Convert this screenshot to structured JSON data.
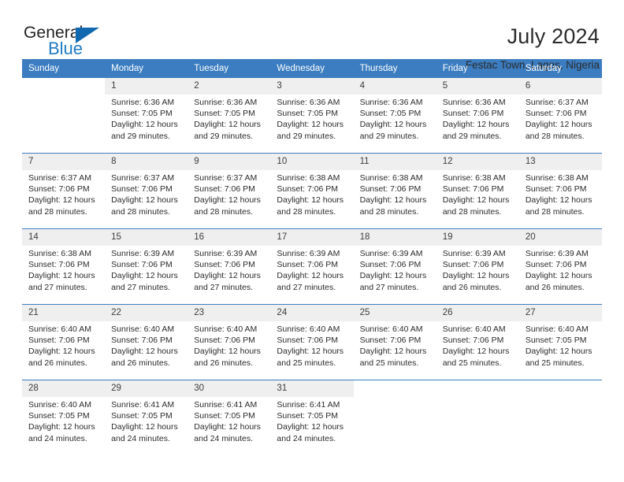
{
  "brand": {
    "name_top": "General",
    "name_bottom": "Blue",
    "triangle_icon": "blue-triangle-icon",
    "color_top": "#221f1f",
    "color_bottom": "#1f7ac4"
  },
  "header": {
    "title": "July 2024",
    "subtitle": "Festac Town, Lagos, Nigeria"
  },
  "theme": {
    "header_bg": "#3b7dc0",
    "daynum_bg": "#efefef",
    "grid_line": "#3b7dc0",
    "text": "#2b2b2b"
  },
  "weekday_headers": [
    "Sunday",
    "Monday",
    "Tuesday",
    "Wednesday",
    "Thursday",
    "Friday",
    "Saturday"
  ],
  "weeks": [
    [
      {
        "day": "",
        "lines": [
          "",
          "",
          "",
          ""
        ]
      },
      {
        "day": "1",
        "lines": [
          "Sunrise: 6:36 AM",
          "Sunset: 7:05 PM",
          "Daylight: 12 hours",
          "and 29 minutes."
        ]
      },
      {
        "day": "2",
        "lines": [
          "Sunrise: 6:36 AM",
          "Sunset: 7:05 PM",
          "Daylight: 12 hours",
          "and 29 minutes."
        ]
      },
      {
        "day": "3",
        "lines": [
          "Sunrise: 6:36 AM",
          "Sunset: 7:05 PM",
          "Daylight: 12 hours",
          "and 29 minutes."
        ]
      },
      {
        "day": "4",
        "lines": [
          "Sunrise: 6:36 AM",
          "Sunset: 7:05 PM",
          "Daylight: 12 hours",
          "and 29 minutes."
        ]
      },
      {
        "day": "5",
        "lines": [
          "Sunrise: 6:36 AM",
          "Sunset: 7:06 PM",
          "Daylight: 12 hours",
          "and 29 minutes."
        ]
      },
      {
        "day": "6",
        "lines": [
          "Sunrise: 6:37 AM",
          "Sunset: 7:06 PM",
          "Daylight: 12 hours",
          "and 28 minutes."
        ]
      }
    ],
    [
      {
        "day": "7",
        "lines": [
          "Sunrise: 6:37 AM",
          "Sunset: 7:06 PM",
          "Daylight: 12 hours",
          "and 28 minutes."
        ]
      },
      {
        "day": "8",
        "lines": [
          "Sunrise: 6:37 AM",
          "Sunset: 7:06 PM",
          "Daylight: 12 hours",
          "and 28 minutes."
        ]
      },
      {
        "day": "9",
        "lines": [
          "Sunrise: 6:37 AM",
          "Sunset: 7:06 PM",
          "Daylight: 12 hours",
          "and 28 minutes."
        ]
      },
      {
        "day": "10",
        "lines": [
          "Sunrise: 6:38 AM",
          "Sunset: 7:06 PM",
          "Daylight: 12 hours",
          "and 28 minutes."
        ]
      },
      {
        "day": "11",
        "lines": [
          "Sunrise: 6:38 AM",
          "Sunset: 7:06 PM",
          "Daylight: 12 hours",
          "and 28 minutes."
        ]
      },
      {
        "day": "12",
        "lines": [
          "Sunrise: 6:38 AM",
          "Sunset: 7:06 PM",
          "Daylight: 12 hours",
          "and 28 minutes."
        ]
      },
      {
        "day": "13",
        "lines": [
          "Sunrise: 6:38 AM",
          "Sunset: 7:06 PM",
          "Daylight: 12 hours",
          "and 28 minutes."
        ]
      }
    ],
    [
      {
        "day": "14",
        "lines": [
          "Sunrise: 6:38 AM",
          "Sunset: 7:06 PM",
          "Daylight: 12 hours",
          "and 27 minutes."
        ]
      },
      {
        "day": "15",
        "lines": [
          "Sunrise: 6:39 AM",
          "Sunset: 7:06 PM",
          "Daylight: 12 hours",
          "and 27 minutes."
        ]
      },
      {
        "day": "16",
        "lines": [
          "Sunrise: 6:39 AM",
          "Sunset: 7:06 PM",
          "Daylight: 12 hours",
          "and 27 minutes."
        ]
      },
      {
        "day": "17",
        "lines": [
          "Sunrise: 6:39 AM",
          "Sunset: 7:06 PM",
          "Daylight: 12 hours",
          "and 27 minutes."
        ]
      },
      {
        "day": "18",
        "lines": [
          "Sunrise: 6:39 AM",
          "Sunset: 7:06 PM",
          "Daylight: 12 hours",
          "and 27 minutes."
        ]
      },
      {
        "day": "19",
        "lines": [
          "Sunrise: 6:39 AM",
          "Sunset: 7:06 PM",
          "Daylight: 12 hours",
          "and 26 minutes."
        ]
      },
      {
        "day": "20",
        "lines": [
          "Sunrise: 6:39 AM",
          "Sunset: 7:06 PM",
          "Daylight: 12 hours",
          "and 26 minutes."
        ]
      }
    ],
    [
      {
        "day": "21",
        "lines": [
          "Sunrise: 6:40 AM",
          "Sunset: 7:06 PM",
          "Daylight: 12 hours",
          "and 26 minutes."
        ]
      },
      {
        "day": "22",
        "lines": [
          "Sunrise: 6:40 AM",
          "Sunset: 7:06 PM",
          "Daylight: 12 hours",
          "and 26 minutes."
        ]
      },
      {
        "day": "23",
        "lines": [
          "Sunrise: 6:40 AM",
          "Sunset: 7:06 PM",
          "Daylight: 12 hours",
          "and 26 minutes."
        ]
      },
      {
        "day": "24",
        "lines": [
          "Sunrise: 6:40 AM",
          "Sunset: 7:06 PM",
          "Daylight: 12 hours",
          "and 25 minutes."
        ]
      },
      {
        "day": "25",
        "lines": [
          "Sunrise: 6:40 AM",
          "Sunset: 7:06 PM",
          "Daylight: 12 hours",
          "and 25 minutes."
        ]
      },
      {
        "day": "26",
        "lines": [
          "Sunrise: 6:40 AM",
          "Sunset: 7:06 PM",
          "Daylight: 12 hours",
          "and 25 minutes."
        ]
      },
      {
        "day": "27",
        "lines": [
          "Sunrise: 6:40 AM",
          "Sunset: 7:05 PM",
          "Daylight: 12 hours",
          "and 25 minutes."
        ]
      }
    ],
    [
      {
        "day": "28",
        "lines": [
          "Sunrise: 6:40 AM",
          "Sunset: 7:05 PM",
          "Daylight: 12 hours",
          "and 24 minutes."
        ]
      },
      {
        "day": "29",
        "lines": [
          "Sunrise: 6:41 AM",
          "Sunset: 7:05 PM",
          "Daylight: 12 hours",
          "and 24 minutes."
        ]
      },
      {
        "day": "30",
        "lines": [
          "Sunrise: 6:41 AM",
          "Sunset: 7:05 PM",
          "Daylight: 12 hours",
          "and 24 minutes."
        ]
      },
      {
        "day": "31",
        "lines": [
          "Sunrise: 6:41 AM",
          "Sunset: 7:05 PM",
          "Daylight: 12 hours",
          "and 24 minutes."
        ]
      },
      {
        "day": "",
        "lines": [
          "",
          "",
          "",
          ""
        ]
      },
      {
        "day": "",
        "lines": [
          "",
          "",
          "",
          ""
        ]
      },
      {
        "day": "",
        "lines": [
          "",
          "",
          "",
          ""
        ]
      }
    ]
  ]
}
